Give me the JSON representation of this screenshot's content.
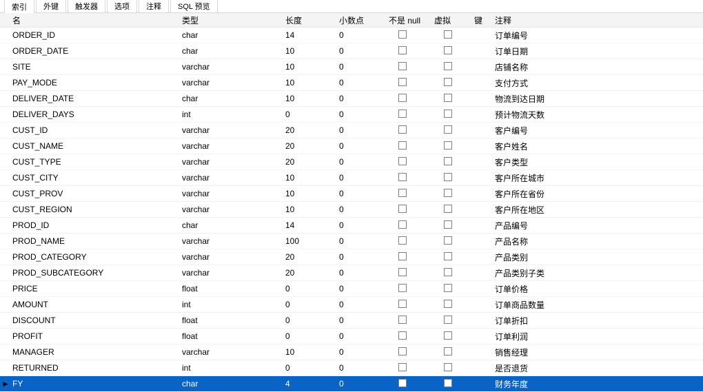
{
  "tabs": [
    "索引",
    "外键",
    "触发器",
    "选项",
    "注释",
    "SQL 预览"
  ],
  "activeTab": 0,
  "header": {
    "name": "名",
    "type": "类型",
    "length": "长度",
    "decimals": "小数点",
    "notNull": "不是 null",
    "virtual": "虚拟",
    "key": "键",
    "comment": "注释"
  },
  "rows": [
    {
      "name": "ORDER_ID",
      "type": "char",
      "length": "14",
      "decimals": "0",
      "notNull": false,
      "virtual": false,
      "key": "",
      "comment": "订单编号",
      "selected": false
    },
    {
      "name": "ORDER_DATE",
      "type": "char",
      "length": "10",
      "decimals": "0",
      "notNull": false,
      "virtual": false,
      "key": "",
      "comment": "订单日期",
      "selected": false
    },
    {
      "name": "SITE",
      "type": "varchar",
      "length": "10",
      "decimals": "0",
      "notNull": false,
      "virtual": false,
      "key": "",
      "comment": "店铺名称",
      "selected": false
    },
    {
      "name": "PAY_MODE",
      "type": "varchar",
      "length": "10",
      "decimals": "0",
      "notNull": false,
      "virtual": false,
      "key": "",
      "comment": "支付方式",
      "selected": false
    },
    {
      "name": "DELIVER_DATE",
      "type": "char",
      "length": "10",
      "decimals": "0",
      "notNull": false,
      "virtual": false,
      "key": "",
      "comment": "物流到达日期",
      "selected": false
    },
    {
      "name": "DELIVER_DAYS",
      "type": "int",
      "length": "0",
      "decimals": "0",
      "notNull": false,
      "virtual": false,
      "key": "",
      "comment": "预计物流天数",
      "selected": false
    },
    {
      "name": "CUST_ID",
      "type": "varchar",
      "length": "20",
      "decimals": "0",
      "notNull": false,
      "virtual": false,
      "key": "",
      "comment": "客户编号",
      "selected": false
    },
    {
      "name": "CUST_NAME",
      "type": "varchar",
      "length": "20",
      "decimals": "0",
      "notNull": false,
      "virtual": false,
      "key": "",
      "comment": "客户姓名",
      "selected": false
    },
    {
      "name": "CUST_TYPE",
      "type": "varchar",
      "length": "20",
      "decimals": "0",
      "notNull": false,
      "virtual": false,
      "key": "",
      "comment": "客户类型",
      "selected": false
    },
    {
      "name": "CUST_CITY",
      "type": "varchar",
      "length": "10",
      "decimals": "0",
      "notNull": false,
      "virtual": false,
      "key": "",
      "comment": "客户所在城市",
      "selected": false
    },
    {
      "name": "CUST_PROV",
      "type": "varchar",
      "length": "10",
      "decimals": "0",
      "notNull": false,
      "virtual": false,
      "key": "",
      "comment": "客户所在省份",
      "selected": false
    },
    {
      "name": "CUST_REGION",
      "type": "varchar",
      "length": "10",
      "decimals": "0",
      "notNull": false,
      "virtual": false,
      "key": "",
      "comment": "客户所在地区",
      "selected": false
    },
    {
      "name": "PROD_ID",
      "type": "char",
      "length": "14",
      "decimals": "0",
      "notNull": false,
      "virtual": false,
      "key": "",
      "comment": "产品编号",
      "selected": false
    },
    {
      "name": "PROD_NAME",
      "type": "varchar",
      "length": "100",
      "decimals": "0",
      "notNull": false,
      "virtual": false,
      "key": "",
      "comment": "产品名称",
      "selected": false
    },
    {
      "name": "PROD_CATEGORY",
      "type": "varchar",
      "length": "20",
      "decimals": "0",
      "notNull": false,
      "virtual": false,
      "key": "",
      "comment": "产品类别",
      "selected": false
    },
    {
      "name": "PROD_SUBCATEGORY",
      "type": "varchar",
      "length": "20",
      "decimals": "0",
      "notNull": false,
      "virtual": false,
      "key": "",
      "comment": "产品类别子类",
      "selected": false
    },
    {
      "name": "PRICE",
      "type": "float",
      "length": "0",
      "decimals": "0",
      "notNull": false,
      "virtual": false,
      "key": "",
      "comment": "订单价格",
      "selected": false
    },
    {
      "name": "AMOUNT",
      "type": "int",
      "length": "0",
      "decimals": "0",
      "notNull": false,
      "virtual": false,
      "key": "",
      "comment": "订单商品数量",
      "selected": false
    },
    {
      "name": "DISCOUNT",
      "type": "float",
      "length": "0",
      "decimals": "0",
      "notNull": false,
      "virtual": false,
      "key": "",
      "comment": "订单折扣",
      "selected": false
    },
    {
      "name": "PROFIT",
      "type": "float",
      "length": "0",
      "decimals": "0",
      "notNull": false,
      "virtual": false,
      "key": "",
      "comment": "订单利润",
      "selected": false
    },
    {
      "name": "MANAGER",
      "type": "varchar",
      "length": "10",
      "decimals": "0",
      "notNull": false,
      "virtual": false,
      "key": "",
      "comment": "销售经理",
      "selected": false
    },
    {
      "name": "RETURNED",
      "type": "int",
      "length": "0",
      "decimals": "0",
      "notNull": false,
      "virtual": false,
      "key": "",
      "comment": "是否退货",
      "selected": false
    },
    {
      "name": "FY",
      "type": "char",
      "length": "4",
      "decimals": "0",
      "notNull": false,
      "virtual": false,
      "key": "",
      "comment": "财务年度",
      "selected": true
    }
  ]
}
